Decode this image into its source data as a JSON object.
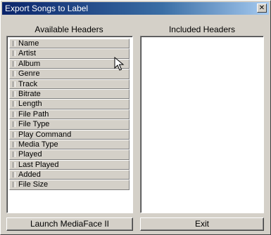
{
  "window": {
    "title": "Export Songs to Label",
    "close_glyph": "✕"
  },
  "available": {
    "header": "Available Headers",
    "items": [
      "Name",
      "Artist",
      "Album",
      "Genre",
      "Track",
      "Bitrate",
      "Length",
      "File Path",
      "File Type",
      "Play Command",
      "Media Type",
      "Played",
      "Last Played",
      "Added",
      "File Size"
    ]
  },
  "included": {
    "header": "Included Headers",
    "items": []
  },
  "buttons": {
    "launch": "Launch MediaFace II",
    "exit": "Exit"
  },
  "icons": {
    "cursor": "arrow-cursor-icon",
    "item_grip": "drag-grip-icon"
  }
}
